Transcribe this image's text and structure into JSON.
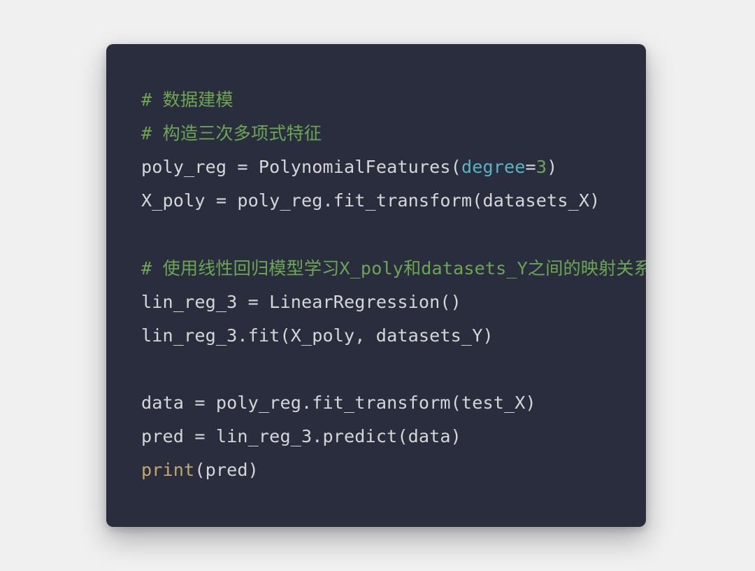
{
  "code": {
    "lines": [
      {
        "tokens": [
          {
            "cls": "comment",
            "text": "# 数据建模"
          }
        ]
      },
      {
        "tokens": [
          {
            "cls": "comment",
            "text": "# 构造三次多项式特征"
          }
        ]
      },
      {
        "tokens": [
          {
            "cls": "default",
            "text": "poly_reg "
          },
          {
            "cls": "operator",
            "text": "="
          },
          {
            "cls": "default",
            "text": " PolynomialFeatures("
          },
          {
            "cls": "param",
            "text": "degree"
          },
          {
            "cls": "operator",
            "text": "="
          },
          {
            "cls": "number",
            "text": "3"
          },
          {
            "cls": "default",
            "text": ")"
          }
        ]
      },
      {
        "tokens": [
          {
            "cls": "default",
            "text": "X_poly "
          },
          {
            "cls": "operator",
            "text": "="
          },
          {
            "cls": "default",
            "text": " poly_reg.fit_transform(datasets_X)"
          }
        ]
      },
      {
        "tokens": [
          {
            "cls": "default",
            "text": ""
          }
        ]
      },
      {
        "tokens": [
          {
            "cls": "comment",
            "text": "# 使用线性回归模型学习X_poly和datasets_Y之间的映射关系"
          }
        ]
      },
      {
        "tokens": [
          {
            "cls": "default",
            "text": "lin_reg_3 "
          },
          {
            "cls": "operator",
            "text": "="
          },
          {
            "cls": "default",
            "text": " LinearRegression()"
          }
        ]
      },
      {
        "tokens": [
          {
            "cls": "default",
            "text": "lin_reg_3.fit(X_poly, datasets_Y)"
          }
        ]
      },
      {
        "tokens": [
          {
            "cls": "default",
            "text": ""
          }
        ]
      },
      {
        "tokens": [
          {
            "cls": "default",
            "text": "data "
          },
          {
            "cls": "operator",
            "text": "="
          },
          {
            "cls": "default",
            "text": " poly_reg.fit_transform(test_X)"
          }
        ]
      },
      {
        "tokens": [
          {
            "cls": "default",
            "text": "pred "
          },
          {
            "cls": "operator",
            "text": "="
          },
          {
            "cls": "default",
            "text": " lin_reg_3.predict(data)"
          }
        ]
      },
      {
        "tokens": [
          {
            "cls": "builtin",
            "text": "print"
          },
          {
            "cls": "default",
            "text": "(pred)"
          }
        ]
      }
    ]
  }
}
